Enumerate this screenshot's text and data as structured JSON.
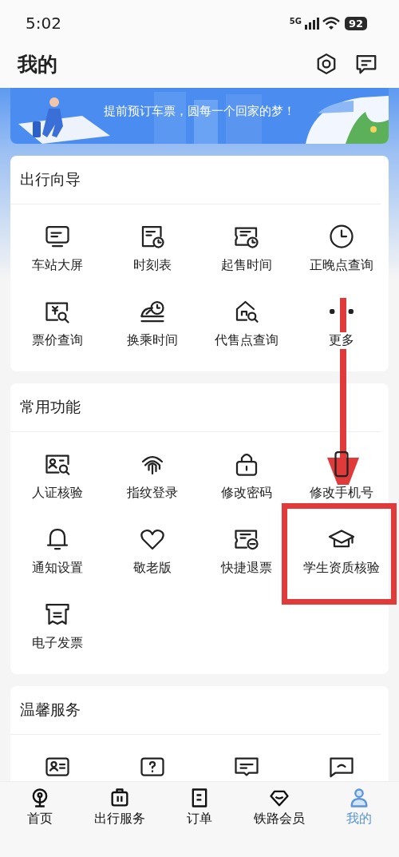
{
  "status_bar": {
    "time": "5:02",
    "network": "5G",
    "battery": "92"
  },
  "header": {
    "title": "我的"
  },
  "banner": {
    "subtitle": "提前预订车票，圆每一个回家的梦！"
  },
  "sections": [
    {
      "title": "出行向导",
      "items": [
        "车站大屏",
        "时刻表",
        "起售时间",
        "正晚点查询",
        "票价查询",
        "换乘时间",
        "代售点查询",
        "更多"
      ]
    },
    {
      "title": "常用功能",
      "items": [
        "人证核验",
        "指纹登录",
        "修改密码",
        "修改手机号",
        "通知设置",
        "敬老版",
        "快捷退票",
        "学生资质核验",
        "电子发票"
      ]
    },
    {
      "title": "温馨服务"
    }
  ],
  "tab_bar": [
    {
      "label": "首页",
      "selected": false
    },
    {
      "label": "出行服务",
      "selected": false
    },
    {
      "label": "订单",
      "selected": false
    },
    {
      "label": "铁路会员",
      "selected": false
    },
    {
      "label": "我的",
      "selected": true
    }
  ]
}
